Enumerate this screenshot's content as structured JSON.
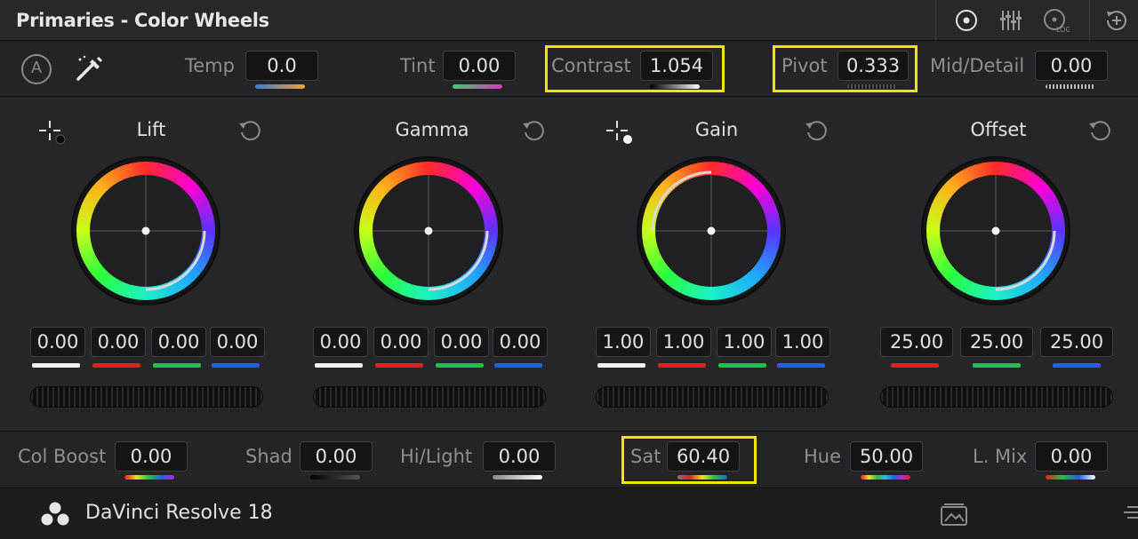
{
  "panel": {
    "title": "Primaries - Color Wheels"
  },
  "title_icons": [
    "color-wheels-icon",
    "primaries-bars-icon",
    "log-wheels-icon",
    "reset-add-icon"
  ],
  "top_params": {
    "auto_label": "A",
    "temp": {
      "label": "Temp",
      "value": "0.0"
    },
    "tint": {
      "label": "Tint",
      "value": "0.00"
    },
    "contrast": {
      "label": "Contrast",
      "value": "1.054",
      "highlighted": true
    },
    "pivot": {
      "label": "Pivot",
      "value": "0.333",
      "highlighted": true
    },
    "mid_detail": {
      "label": "Mid/Detail",
      "value": "0.00"
    }
  },
  "wheels": [
    {
      "label": "Lift",
      "values": [
        "0.00",
        "0.00",
        "0.00",
        "0.00"
      ]
    },
    {
      "label": "Gamma",
      "values": [
        "0.00",
        "0.00",
        "0.00",
        "0.00"
      ]
    },
    {
      "label": "Gain",
      "values": [
        "1.00",
        "1.00",
        "1.00",
        "1.00"
      ]
    },
    {
      "label": "Offset",
      "values": [
        "25.00",
        "25.00",
        "25.00"
      ]
    }
  ],
  "bottom_params": {
    "col_boost": {
      "label": "Col Boost",
      "value": "0.00"
    },
    "shad": {
      "label": "Shad",
      "value": "0.00"
    },
    "hi_light": {
      "label": "Hi/Light",
      "value": "0.00"
    },
    "sat": {
      "label": "Sat",
      "value": "60.40",
      "highlighted": true
    },
    "hue": {
      "label": "Hue",
      "value": "50.00"
    },
    "l_mix": {
      "label": "L. Mix",
      "value": "0.00"
    }
  },
  "footer": {
    "app_name": "DaVinci Resolve 18"
  },
  "colors": {
    "highlight": "#f2e300",
    "panel": "#262628",
    "field": "#161617"
  }
}
